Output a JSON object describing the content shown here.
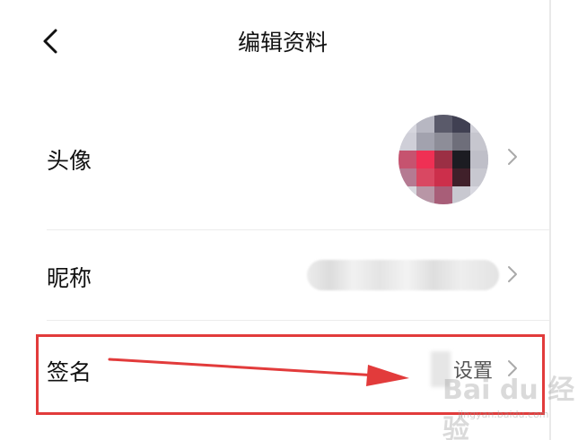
{
  "header": {
    "title": "编辑资料",
    "back_icon": "chevron-left-icon"
  },
  "rows": {
    "avatar": {
      "label": "头像",
      "chevron_icon": "chevron-right-icon"
    },
    "nickname": {
      "label": "昵称",
      "chevron_icon": "chevron-right-icon"
    },
    "signature": {
      "label": "签名",
      "value": "设置",
      "chevron_icon": "chevron-right-icon"
    }
  },
  "annotation": {
    "highlight_color": "#e23b3b",
    "arrow_color": "#e23b3b"
  },
  "watermark": {
    "text": "Bai du 经验",
    "sub": "jingyan.baidu.com"
  }
}
